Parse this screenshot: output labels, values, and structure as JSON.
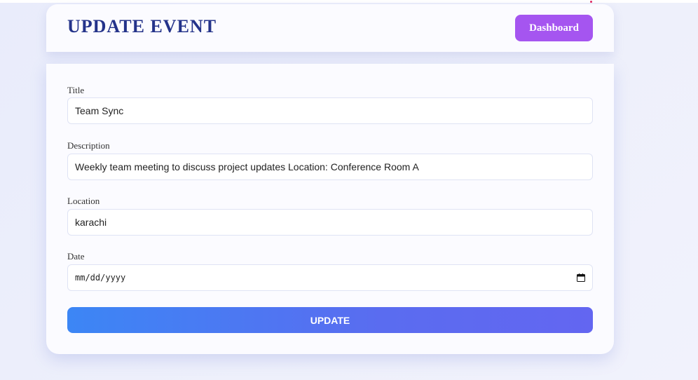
{
  "header": {
    "title": "UPDATE EVENT",
    "dashboard_label": "Dashboard"
  },
  "form": {
    "title": {
      "label": "Title",
      "value": "Team Sync"
    },
    "description": {
      "label": "Description",
      "value": "Weekly team meeting to discuss project updates Location: Conference Room A"
    },
    "location": {
      "label": "Location",
      "value": "karachi"
    },
    "date": {
      "label": "Date",
      "placeholder": "mm/dd/yyyy",
      "icon": "calendar-icon"
    },
    "submit_label": "UPDATE"
  },
  "colors": {
    "title": "#24338a",
    "dashboard_button": "#a555f0",
    "update_gradient_start": "#3c86f5",
    "update_gradient_end": "#6366f1"
  }
}
